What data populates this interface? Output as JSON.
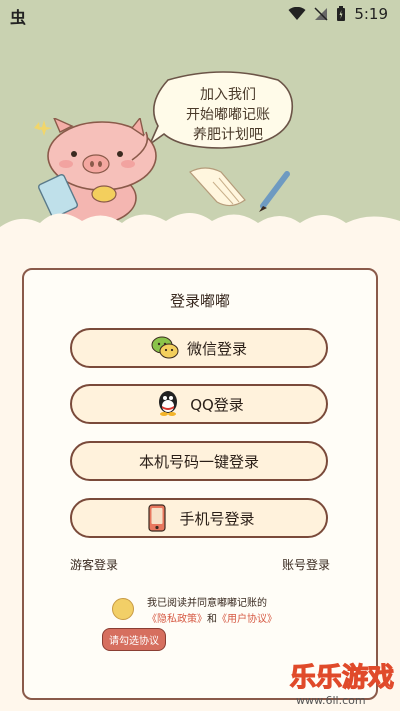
{
  "status_bar": {
    "app_icon": "虫",
    "time": "5:19"
  },
  "banner": {
    "speech": [
      "加入我们",
      "开始嘟嘟记账",
      "养肥计划吧"
    ]
  },
  "login": {
    "title": "登录嘟嘟",
    "buttons": [
      {
        "label": "微信登录",
        "icon": "wechat-icon"
      },
      {
        "label": "QQ登录",
        "icon": "qq-icon"
      },
      {
        "label": "本机号码一键登录",
        "icon": ""
      },
      {
        "label": "手机号登录",
        "icon": "phone-icon"
      }
    ],
    "guest_label": "游客登录",
    "account_label": "账号登录",
    "agreement": {
      "prefix": "我已阅读并同意嘟嘟记账的",
      "privacy": "《隐私政策》",
      "and": "和",
      "terms": "《用户协议》"
    },
    "tooltip": "请勾选协议"
  },
  "watermark": {
    "brand": "乐乐游戏",
    "url": "www.6ll.com"
  }
}
